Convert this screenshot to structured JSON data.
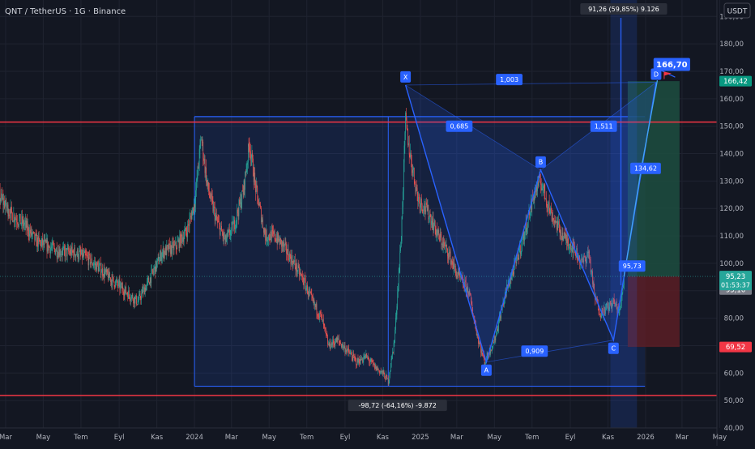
{
  "header": {
    "title": "QNT / TetherUS · 1G · Binance",
    "currency_button": "USDT"
  },
  "colors": {
    "background": "#131722",
    "grid": "#1f2330",
    "axis_text": "#b2b5be",
    "up": "#26a69a",
    "down": "#ef5350",
    "pattern_blue": "#2962ff",
    "red_line": "#f23645",
    "target_zone": "#1d4d3f",
    "stop_zone": "#5a1d24"
  },
  "chart_data": {
    "type": "candlestick",
    "ylim": [
      40,
      196
    ],
    "y_ticks": [
      40,
      50,
      60,
      70,
      80,
      90,
      100,
      110,
      120,
      130,
      140,
      150,
      160,
      170,
      180,
      190
    ],
    "y_tick_labels": [
      "40,00",
      "50,00",
      "60,00",
      "70,00",
      "80,00",
      "90,00",
      "100,00",
      "110,00",
      "120,00",
      "130,00",
      "140,00",
      "150,00",
      "160,00",
      "170,00",
      "180,00",
      "190,00"
    ],
    "x_ticks": [
      {
        "label": "Mar",
        "date": "2023-03-01"
      },
      {
        "label": "May",
        "date": "2023-05-01"
      },
      {
        "label": "Tem",
        "date": "2023-07-01"
      },
      {
        "label": "Eyl",
        "date": "2023-09-01"
      },
      {
        "label": "Kas",
        "date": "2023-11-01"
      },
      {
        "label": "2024",
        "date": "2024-01-01"
      },
      {
        "label": "Mar",
        "date": "2024-03-01"
      },
      {
        "label": "May",
        "date": "2024-05-01"
      },
      {
        "label": "Tem",
        "date": "2024-07-01"
      },
      {
        "label": "Eyl",
        "date": "2024-09-01"
      },
      {
        "label": "Kas",
        "date": "2024-11-01"
      },
      {
        "label": "2025",
        "date": "2025-01-01"
      },
      {
        "label": "Mar",
        "date": "2025-03-01"
      },
      {
        "label": "May",
        "date": "2025-05-01"
      },
      {
        "label": "Tem",
        "date": "2025-07-01"
      },
      {
        "label": "Eyl",
        "date": "2025-09-01"
      },
      {
        "label": "Kas",
        "date": "2025-11-01"
      },
      {
        "label": "2026",
        "date": "2026-01-01"
      },
      {
        "label": "Mar",
        "date": "2026-03-01"
      },
      {
        "label": "May",
        "date": "2026-05-01"
      }
    ],
    "price_path": [
      [
        "2023-01-01",
        120
      ],
      [
        "2023-01-15",
        128
      ],
      [
        "2023-02-01",
        132
      ],
      [
        "2023-02-20",
        124
      ],
      [
        "2023-03-10",
        118
      ],
      [
        "2023-04-01",
        114
      ],
      [
        "2023-04-20",
        108
      ],
      [
        "2023-05-10",
        106
      ],
      [
        "2023-06-01",
        104
      ],
      [
        "2023-06-20",
        104
      ],
      [
        "2023-07-10",
        102
      ],
      [
        "2023-08-01",
        98
      ],
      [
        "2023-08-20",
        94
      ],
      [
        "2023-09-10",
        90
      ],
      [
        "2023-10-01",
        86
      ],
      [
        "2023-10-20",
        94
      ],
      [
        "2023-11-10",
        104
      ],
      [
        "2023-12-01",
        106
      ],
      [
        "2023-12-20",
        112
      ],
      [
        "2024-01-01",
        122
      ],
      [
        "2024-01-12",
        146
      ],
      [
        "2024-01-22",
        128
      ],
      [
        "2024-02-05",
        116
      ],
      [
        "2024-02-20",
        108
      ],
      [
        "2024-03-05",
        114
      ],
      [
        "2024-03-20",
        126
      ],
      [
        "2024-03-30",
        144
      ],
      [
        "2024-04-10",
        126
      ],
      [
        "2024-04-25",
        110
      ],
      [
        "2024-05-10",
        110
      ],
      [
        "2024-05-25",
        106
      ],
      [
        "2024-06-10",
        100
      ],
      [
        "2024-06-25",
        94
      ],
      [
        "2024-07-10",
        86
      ],
      [
        "2024-07-25",
        80
      ],
      [
        "2024-08-05",
        70
      ],
      [
        "2024-08-20",
        72
      ],
      [
        "2024-09-05",
        68
      ],
      [
        "2024-09-20",
        64
      ],
      [
        "2024-10-05",
        66
      ],
      [
        "2024-10-20",
        62
      ],
      [
        "2024-11-01",
        60
      ],
      [
        "2024-11-10",
        57
      ],
      [
        "2024-11-20",
        72
      ],
      [
        "2024-12-01",
        110
      ],
      [
        "2024-12-08",
        152
      ],
      [
        "2024-12-15",
        140
      ],
      [
        "2024-12-28",
        124
      ],
      [
        "2025-01-15",
        118
      ],
      [
        "2025-01-30",
        110
      ],
      [
        "2025-02-15",
        104
      ],
      [
        "2025-03-01",
        96
      ],
      [
        "2025-03-20",
        90
      ],
      [
        "2025-04-05",
        72
      ],
      [
        "2025-04-15",
        64
      ],
      [
        "2025-05-01",
        72
      ],
      [
        "2025-05-20",
        90
      ],
      [
        "2025-06-05",
        100
      ],
      [
        "2025-06-20",
        112
      ],
      [
        "2025-07-05",
        126
      ],
      [
        "2025-07-15",
        130
      ],
      [
        "2025-08-01",
        118
      ],
      [
        "2025-08-20",
        110
      ],
      [
        "2025-09-05",
        106
      ],
      [
        "2025-09-20",
        100
      ],
      [
        "2025-10-01",
        104
      ],
      [
        "2025-10-10",
        88
      ],
      [
        "2025-10-20",
        82
      ],
      [
        "2025-11-01",
        84
      ],
      [
        "2025-11-10",
        86
      ],
      [
        "2025-11-20",
        82
      ],
      [
        "2025-11-27",
        95.23
      ]
    ],
    "current_price": {
      "value": 95.23,
      "label": "95,23",
      "countdown": "01:53:37"
    },
    "price_tags": [
      {
        "value": 166.42,
        "label": "166,42",
        "color": "#089981"
      },
      {
        "value": 95.16,
        "label": "95,16",
        "color": "#787b86"
      },
      {
        "value": 69.52,
        "label": "69,52",
        "color": "#f23645"
      }
    ],
    "horizontal_lines": [
      {
        "value": 151.5,
        "color": "#f23645"
      },
      {
        "value": 51.8,
        "color": "#f23645"
      }
    ],
    "harmonic_pattern": {
      "points": [
        {
          "label": "X",
          "date": "2024-12-08",
          "value": 165
        },
        {
          "label": "A",
          "date": "2025-04-18",
          "value": 64
        },
        {
          "label": "B",
          "date": "2025-07-15",
          "value": 134
        },
        {
          "label": "C",
          "date": "2025-11-10",
          "value": 72
        },
        {
          "label": "D",
          "date": "2026-01-18",
          "value": 166
        }
      ],
      "ratios": [
        {
          "label": "1,003",
          "date": "2025-05-25",
          "value": 167
        },
        {
          "label": "0,685",
          "date": "2025-03-05",
          "value": 150
        },
        {
          "label": "1,511",
          "date": "2025-10-25",
          "value": 150
        },
        {
          "label": "0,909",
          "date": "2025-07-05",
          "value": 68
        }
      ]
    },
    "range_box": {
      "start": "2024-01-01",
      "end": "2025-12-31",
      "top": 153.5,
      "bottom": 55.2,
      "inner_split": "2024-11-10",
      "label": "-98,72 (-64,16%) -9.872",
      "label_date": "2024-11-25",
      "label_value": 51.5
    },
    "projection": {
      "path": [
        [
          "2025-11-27",
          95.23
        ],
        [
          "2025-12-25",
          134.62
        ],
        [
          "2026-01-20",
          166.7
        ]
      ],
      "labels": [
        {
          "label": "95,73",
          "date": "2025-12-10",
          "value": 99
        },
        {
          "label": "134,62",
          "date": "2026-01-01",
          "value": 134.62
        }
      ],
      "target_label": "166,70",
      "target_date": "2026-02-02",
      "target_value": 172.5
    },
    "measure_box": {
      "start": "2025-11-05",
      "end": "2025-12-18",
      "label": "91,26 (59,85%) 9.126",
      "line_date": "2025-11-22"
    },
    "position_box": {
      "start": "2025-12-03",
      "end": "2026-02-25",
      "entry": 95.23,
      "target": 166.42,
      "stop": 69.52
    }
  }
}
